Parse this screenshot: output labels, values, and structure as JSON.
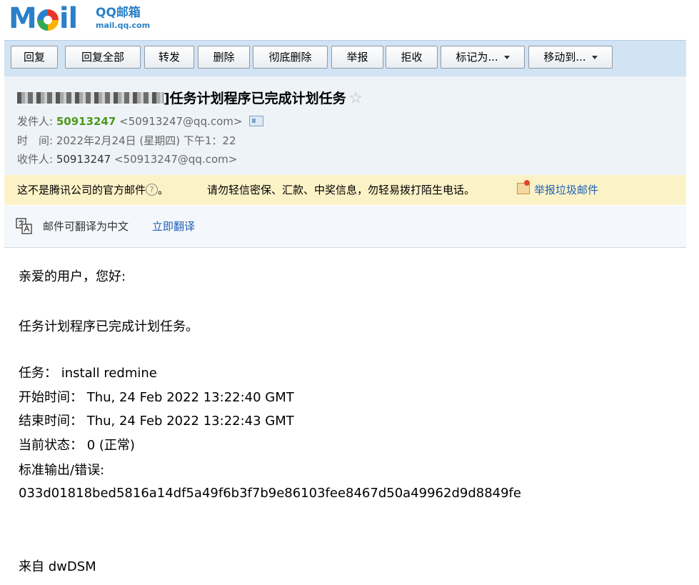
{
  "logo": {
    "brand": "M",
    "brand_tail": "il",
    "product": "QQ邮箱",
    "url": "mail.qq.com"
  },
  "toolbar": {
    "reply": "回复",
    "reply_all": "回复全部",
    "forward": "转发",
    "delete": "删除",
    "delete_permanent": "彻底删除",
    "report": "举报",
    "reject": "拒收",
    "mark_as": "标记为...",
    "move_to": "移动到..."
  },
  "email": {
    "subject_suffix": "]任务计划程序已完成计划任务",
    "from_label": "发件人:",
    "from_name": "50913247",
    "from_address": "<50913247@qq.com>",
    "time_label": "时　间:",
    "time_value": "2022年2月24日 (星期四) 下午1：22",
    "to_label": "收件人:",
    "to_name": "50913247",
    "to_address": "<50913247@qq.com>"
  },
  "warning": {
    "official": "这不是腾讯公司的官方邮件",
    "official_end": "。",
    "notice": "请勿轻信密保、汇款、中奖信息，勿轻易拨打陌生电话。",
    "report_spam": "举报垃圾邮件"
  },
  "translate": {
    "text": "邮件可翻译为中文",
    "link": "立即翻译"
  },
  "body": {
    "greeting": "亲爱的用户，您好:",
    "intro": "任务计划程序已完成计划任务。",
    "task": "任务： install redmine",
    "start": "开始时间： Thu, 24 Feb 2022 13:22:40 GMT",
    "end": "结束时间： Thu, 24 Feb 2022 13:22:43 GMT",
    "status": "当前状态： 0 (正常)",
    "output_label": "标准输出/错误:",
    "output_value": "033d01818bed5816a14df5a49f6b3f7b9e86103fee8467d50a49962d9d8849fe",
    "signature": "来自 dwDSM"
  }
}
